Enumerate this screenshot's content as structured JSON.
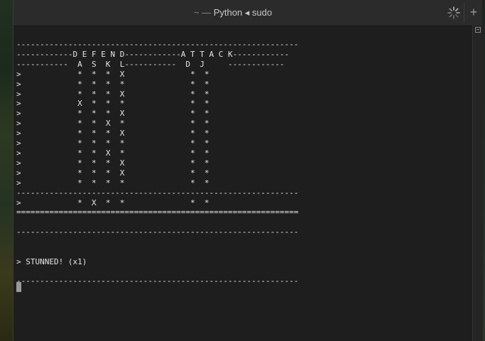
{
  "window": {
    "title_prefix": "~ —",
    "title": "Python ◂ sudo",
    "new_tab_label": "+"
  },
  "terminal": {
    "lines": [
      "------------------------------------------------------------",
      "------------D E F E N D------------A T T A C K------------",
      "-----------  A  S  K  L-----------  D  J     ------------",
      ">            *  *  *  X              *  *",
      ">            *  *  *  *              *  *",
      ">            *  *  *  X              *  *",
      ">            X  *  *  *              *  *",
      ">            *  *  *  X              *  *",
      ">            *  *  X  *              *  *",
      ">            *  *  *  X              *  *",
      ">            *  *  *  *              *  *",
      ">            *  *  X  *              *  *",
      ">            *  *  *  X              *  *",
      ">            *  *  *  X              *  *",
      ">            *  *  *  *              *  *",
      "------------------------------------------------------------",
      ">            *  X  *  *              *  *",
      "============================================================",
      "",
      "------------------------------------------------------------",
      "",
      "",
      "> STUNNED! (x1)"
    ],
    "bottom_rule": "------------------------------------------------------------"
  }
}
